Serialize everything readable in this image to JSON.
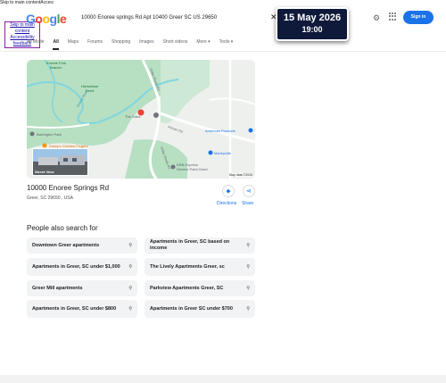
{
  "skip": {
    "top_text": "Skip to main contentAccessibility help",
    "links": [
      "Skip to main",
      "content",
      "Accessibility",
      "feedback"
    ]
  },
  "logo": [
    "G",
    "o",
    "o",
    "g",
    "l",
    "e"
  ],
  "search": {
    "query": "10000 Enoree springs Rd Apt 10400 Greer SC US 29650"
  },
  "date_badge": {
    "date": "15 May 2026",
    "time": "19:00"
  },
  "header": {
    "sign_in": "Sign in"
  },
  "tabs": [
    "All Mode",
    "All",
    "Maps",
    "Forums",
    "Shopping",
    "Images",
    "Short videos",
    "More ▾",
    "Tools ▾"
  ],
  "map": {
    "labels": [
      "Enoree Fork",
      "Branch",
      "Horseshoe",
      "Bend",
      "The Oaks",
      "Barrington Park",
      "Zaxby's Chicken Fingers",
      "American Products",
      "Marleyville",
      "DRB Express",
      "Service Point Greer",
      "Gibbs Shoals Rd",
      "Pelham Rd",
      "Enoree River",
      "Gibbs Shoals Rd"
    ],
    "map_data": "Map data ©2026",
    "street_view": "Street View"
  },
  "place": {
    "name": "10000  Enoree Springs Rd",
    "address": "Greer, SC 29650 , USA",
    "directions": "Directions",
    "share": "Share"
  },
  "people_also_search": {
    "title": "People also search for",
    "items": [
      "Downtown Greer apartments",
      "Apartments  in Greer, SC based on income",
      "Apartments  in Greer, SC under $1,000",
      "The Lively Apartments  Greer, sc",
      "Greer Mill apartments",
      "Parkview Apartments  Greer, SC",
      "Apartments  in Greer, SC under $800",
      "Apartments  in Greer SC under $700"
    ]
  },
  "colors": {
    "accent": "#1a73e8",
    "badge_bg": "#0f1a3a",
    "park_green": "#b7dfc2",
    "river": "#7fd6e0"
  }
}
